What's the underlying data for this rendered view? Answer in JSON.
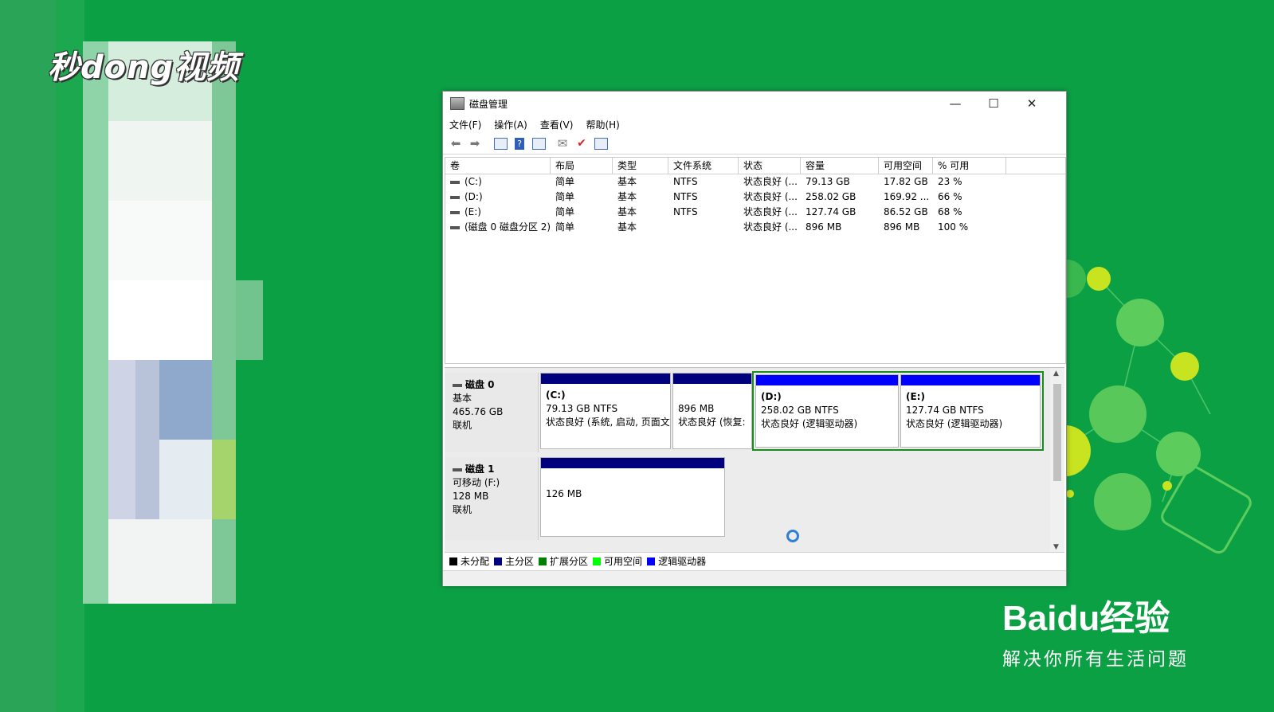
{
  "watermark": {
    "video_logo": "秒dong视频",
    "baidu_brand": "Baidu经验",
    "baidu_tagline": "解决你所有生活问题"
  },
  "window": {
    "title": "磁盘管理",
    "controls": {
      "minimize": "—",
      "maximize": "☐",
      "close": "✕"
    },
    "menu": [
      "文件(F)",
      "操作(A)",
      "查看(V)",
      "帮助(H)"
    ]
  },
  "volume_list": {
    "columns": [
      "卷",
      "布局",
      "类型",
      "文件系统",
      "状态",
      "容量",
      "可用空间",
      "% 可用"
    ],
    "rows": [
      [
        "(C:)",
        "简单",
        "基本",
        "NTFS",
        "状态良好 (...",
        "79.13 GB",
        "17.82 GB",
        "23 %"
      ],
      [
        "(D:)",
        "简单",
        "基本",
        "NTFS",
        "状态良好 (...",
        "258.02 GB",
        "169.92 ...",
        "66 %"
      ],
      [
        "(E:)",
        "简单",
        "基本",
        "NTFS",
        "状态良好 (...",
        "127.74 GB",
        "86.52 GB",
        "68 %"
      ],
      [
        "(磁盘 0 磁盘分区 2)",
        "简单",
        "基本",
        "",
        "状态良好 (...",
        "896 MB",
        "896 MB",
        "100 %"
      ]
    ]
  },
  "disks": [
    {
      "name": "磁盘 0",
      "type": "基本",
      "size": "465.76 GB",
      "state": "联机",
      "partitions": [
        {
          "label": "(C:)",
          "size": "79.13 GB NTFS",
          "status": "状态良好 (系统, 启动, 页面文",
          "kind": "primary"
        },
        {
          "label": "",
          "size": "896 MB",
          "status": "状态良好 (恢复:",
          "kind": "primary"
        },
        {
          "label": "(D:)",
          "size": "258.02 GB NTFS",
          "status": "状态良好 (逻辑驱动器)",
          "kind": "logical"
        },
        {
          "label": "(E:)",
          "size": "127.74 GB NTFS",
          "status": "状态良好 (逻辑驱动器)",
          "kind": "logical"
        }
      ]
    },
    {
      "name": "磁盘 1",
      "type": "可移动 (F:)",
      "size": "128 MB",
      "state": "联机",
      "partitions": [
        {
          "label": "",
          "size": "126 MB",
          "status": "",
          "kind": "primary"
        }
      ]
    }
  ],
  "legend": [
    {
      "label": "未分配",
      "color": "#000000"
    },
    {
      "label": "主分区",
      "color": "#00007f"
    },
    {
      "label": "扩展分区",
      "color": "#008000"
    },
    {
      "label": "可用空间",
      "color": "#00ff00"
    },
    {
      "label": "逻辑驱动器",
      "color": "#0000ff"
    }
  ],
  "colors": {
    "background": "#0ca045",
    "primary_bar": "#00007f",
    "logical_bar": "#0000ff",
    "extended_border": "#1c8a1c"
  }
}
